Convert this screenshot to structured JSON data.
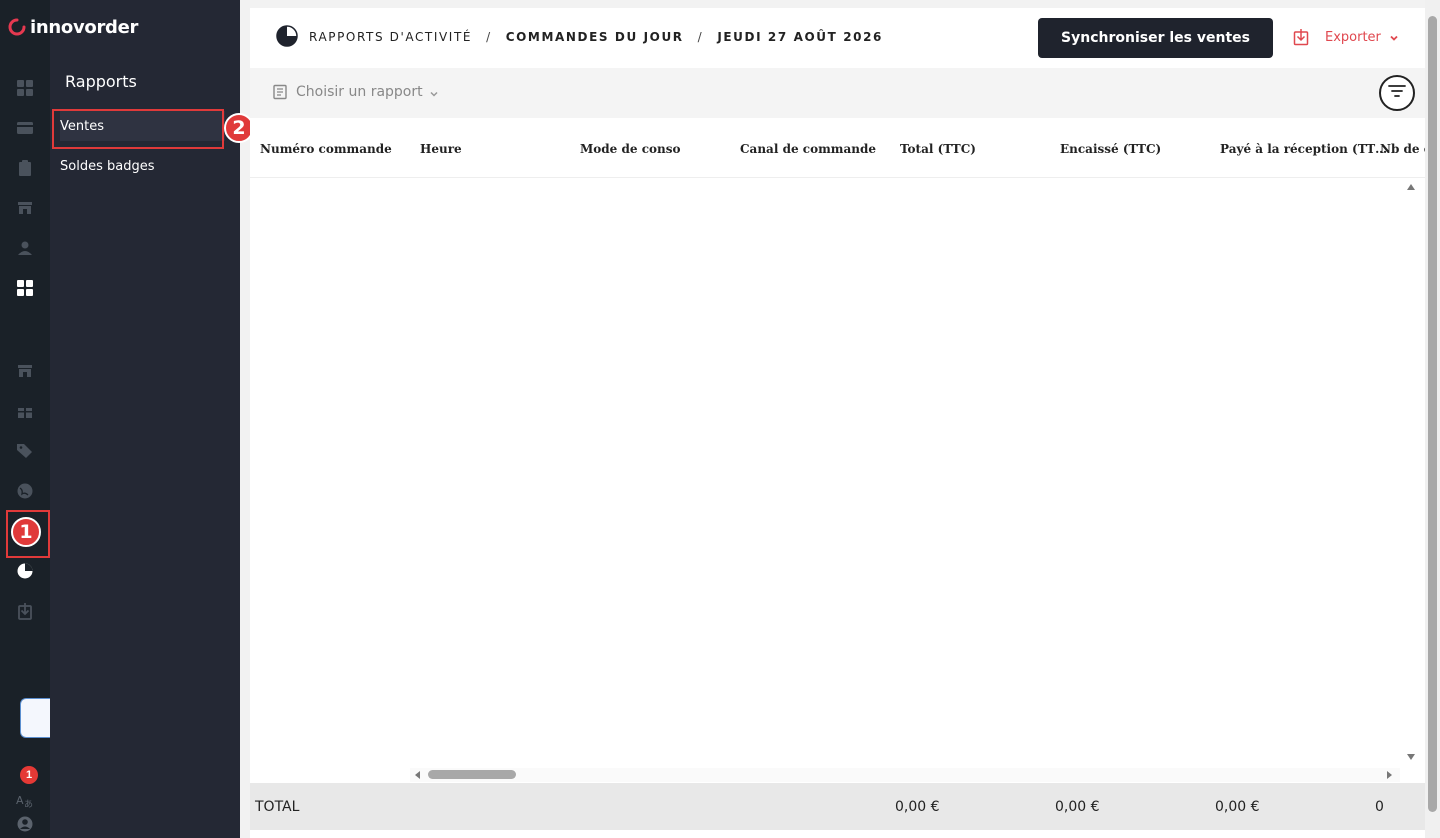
{
  "brand": {
    "name": "innovorder"
  },
  "rail": {
    "callout_number": "1",
    "notification_count": "1"
  },
  "subnav": {
    "title": "Rapports",
    "items": [
      {
        "label": "Ventes"
      },
      {
        "label": "Soldes badges"
      }
    ],
    "callout_number": "2"
  },
  "breadcrumb": {
    "section": "RAPPORTS D'ACTIVITÉ",
    "separator": "/",
    "page": "COMMANDES DU JOUR",
    "date": "JEUDI 27 AOÛT 2026"
  },
  "actions": {
    "sync_label": "Synchroniser les ventes",
    "export_label": "Exporter"
  },
  "report_select": {
    "placeholder": "Choisir un rapport"
  },
  "table": {
    "columns": [
      "Numéro commande",
      "Heure",
      "Mode de conso",
      "Canal de commande",
      "Total (TTC)",
      "Encaissé (TTC)",
      "Payé à la réception (TT…",
      "Nb de c"
    ],
    "rows": []
  },
  "totals": {
    "label": "TOTAL",
    "total_ttc": "0,00 €",
    "encaisse_ttc": "0,00 €",
    "paye_reception": "0,00 €",
    "nb": "0"
  },
  "colors": {
    "rail_bg": "#1a2128",
    "subnav_bg": "#242834",
    "accent_red": "#e0484f",
    "callout_red": "#e03a3a",
    "button_dark": "#1f232d"
  }
}
